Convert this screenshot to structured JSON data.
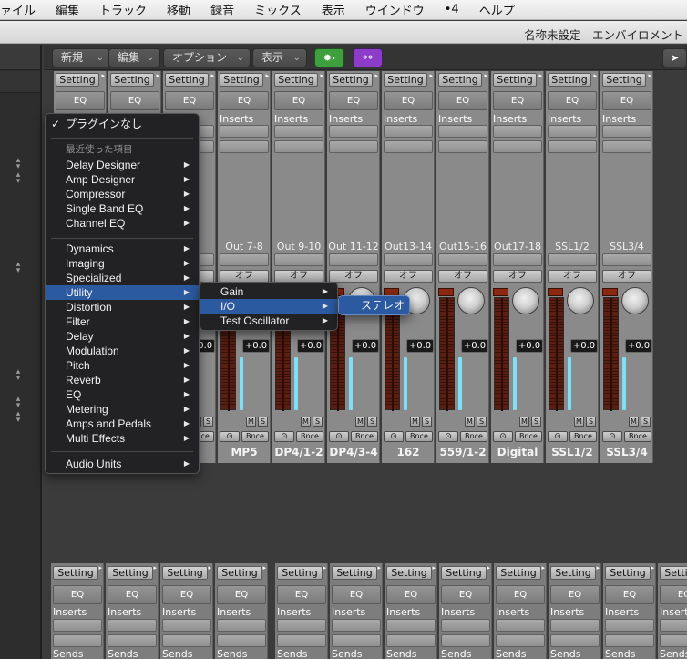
{
  "menubar": {
    "items": [
      "ァイル",
      "編集",
      "トラック",
      "移動",
      "録音",
      "ミックス",
      "表示",
      "ウインドウ",
      "•4",
      "ヘルプ"
    ]
  },
  "titlebar": {
    "title": "名称未設定 - エンバイロメント"
  },
  "toolbar": {
    "new_label": "新規",
    "edit_label": "編集",
    "options_label": "オプション",
    "view_label": "表示",
    "pointer_icon": "pointer-icon"
  },
  "mixer": {
    "setting_label": "Setting",
    "eq_label": "EQ",
    "inserts_label": "Inserts",
    "sends_label": "Sends",
    "auto_label": "オフ",
    "mute_label": "M",
    "solo_label": "S",
    "bounce_label": "Bnce",
    "link_label": "⊙",
    "strips": [
      {
        "output": "",
        "name": "",
        "db": ""
      },
      {
        "output": "",
        "name": "",
        "db": ""
      },
      {
        "output": "6",
        "name": "",
        "db": "+0.0"
      },
      {
        "output": "Out 7-8",
        "name": "MP5",
        "db": "+0.0"
      },
      {
        "output": "Out 9-10",
        "name": "DP4/1-2",
        "db": "+0.0"
      },
      {
        "output": "Out 11-12",
        "name": "DP4/3-4",
        "db": "+0.0"
      },
      {
        "output": "Out13-14",
        "name": "162",
        "db": "+0.0"
      },
      {
        "output": "Out15-16",
        "name": "559/1-2",
        "db": "+0.0"
      },
      {
        "output": "Out17-18",
        "name": "Digital",
        "db": "+0.0"
      },
      {
        "output": "SSL1/2",
        "name": "SSL1/2",
        "db": "+0.0"
      },
      {
        "output": "SSL3/4",
        "name": "SSL3/4",
        "db": "+0.0"
      }
    ]
  },
  "plugin_menu": {
    "none_label": "プラグインなし",
    "recent_header": "最近使った項目",
    "recent": [
      "Delay Designer",
      "Amp Designer",
      "Compressor",
      "Single Band EQ",
      "Channel EQ"
    ],
    "categories": [
      "Dynamics",
      "Imaging",
      "Specialized",
      "Utility",
      "Distortion",
      "Filter",
      "Delay",
      "Modulation",
      "Pitch",
      "Reverb",
      "EQ",
      "Metering",
      "Amps and Pedals",
      "Multi Effects"
    ],
    "audio_units": "Audio Units"
  },
  "utility_menu": {
    "items": [
      "Gain",
      "I/O",
      "Test Oscillator"
    ]
  },
  "io_menu": {
    "items": [
      "ステレオ"
    ]
  }
}
